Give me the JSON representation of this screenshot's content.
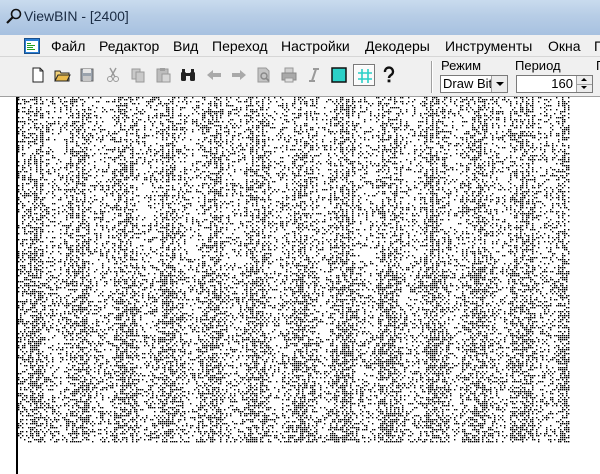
{
  "window": {
    "title": "ViewBIN - [2400]"
  },
  "menu": {
    "items": [
      "Файл",
      "Редактор",
      "Вид",
      "Переход",
      "Настройки",
      "Декодеры",
      "Инструменты",
      "Окна",
      "Г"
    ]
  },
  "toolbar": {
    "icons": [
      "new-file",
      "open-folder",
      "save",
      "cut",
      "copy",
      "paste",
      "find",
      "back",
      "forward",
      "print-preview",
      "print",
      "italic",
      "color-square",
      "grid",
      "help"
    ],
    "mode_label": "Режим",
    "mode_value": "Draw Bit",
    "period_label": "Период",
    "period_value": "160",
    "truncated_label": "Г"
  },
  "colors": {
    "ink": "#000000",
    "paper": "#ffffff",
    "accent": "#2bd0c7"
  }
}
